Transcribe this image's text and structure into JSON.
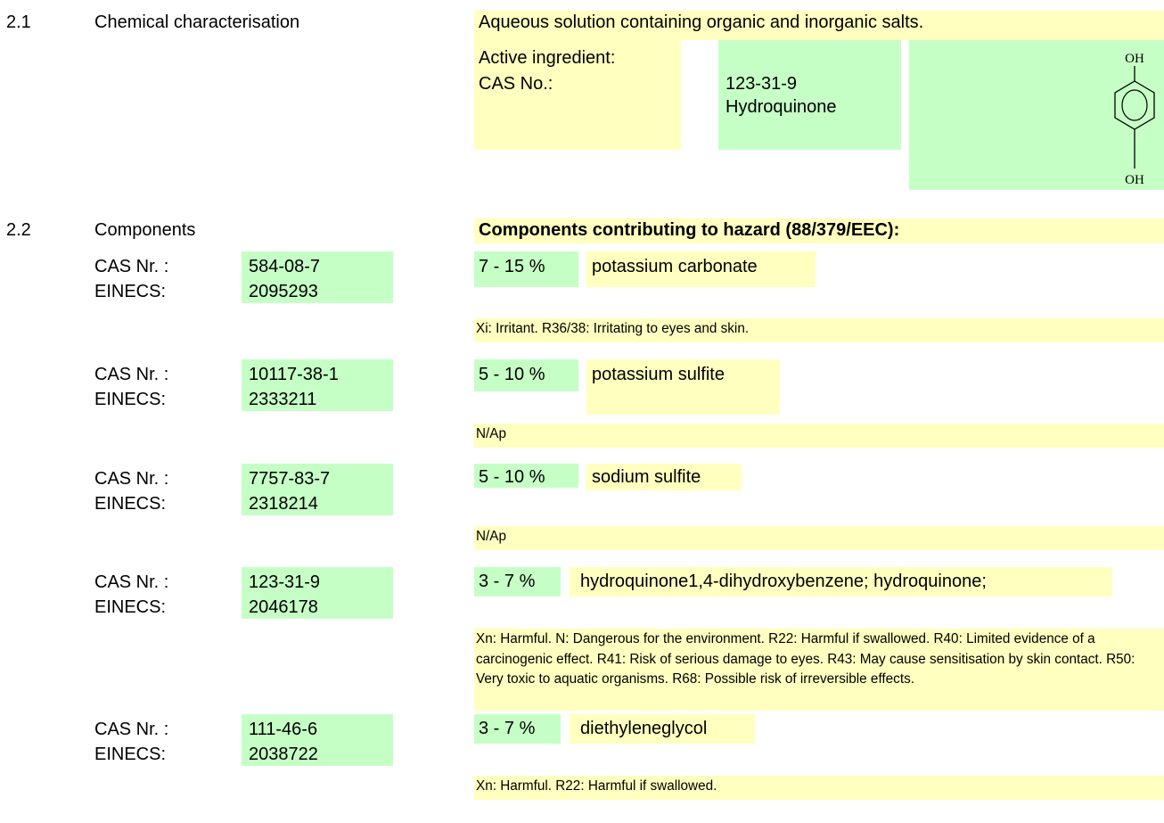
{
  "section_2_1": {
    "number": "2.1",
    "label": "Chemical characterisation",
    "description": "Aqueous solution containing organic and inorganic salts.",
    "active_ingredient_label": "Active ingredient:",
    "cas_label": "CAS No.:",
    "cas_value": "123-31-9",
    "substance_name": "Hydroquinone",
    "structure": {
      "top_group": "OH",
      "bottom_group": "OH"
    }
  },
  "section_2_2": {
    "number": "2.2",
    "label": "Components",
    "header": "Components contributing to hazard (88/379/EEC):",
    "cas_label": "CAS Nr. :",
    "einecs_label": "EINECS:",
    "components": [
      {
        "cas": "584-08-7",
        "einecs": "2095293",
        "range": "7 - 15 %",
        "name": "potassium carbonate",
        "hazard": "Xi: Irritant. R36/38: Irritating to eyes and skin."
      },
      {
        "cas": "10117-38-1",
        "einecs": "2333211",
        "range": "5 - 10 %",
        "name": "potassium  sulfite",
        "hazard": "N/Ap"
      },
      {
        "cas": "7757-83-7",
        "einecs": "2318214",
        "range": "5 - 10 %",
        "name": "sodium sulfite",
        "hazard": "N/Ap"
      },
      {
        "cas": "123-31-9",
        "einecs": "2046178",
        "range": "3 - 7 %",
        "name": "hydroquinone1,4-dihydroxybenzene; hydroquinone;",
        "hazard": "Xn: Harmful. N: Dangerous for the environment. R22: Harmful if swallowed. R40: Limited evidence of a carcinogenic effect. R41: Risk of serious damage to eyes. R43: May cause sensitisation by skin contact. R50: Very toxic to aquatic organisms. R68: Possible risk of irreversible effects."
      },
      {
        "cas": "111-46-6",
        "einecs": "2038722",
        "range": "3 - 7 %",
        "name": "diethyleneglycol",
        "hazard": "Xn: Harmful. R22: Harmful if swallowed."
      }
    ]
  },
  "colors": {
    "yellow_cell": "#ffffc0",
    "green_cell": "#c6ffc6"
  }
}
